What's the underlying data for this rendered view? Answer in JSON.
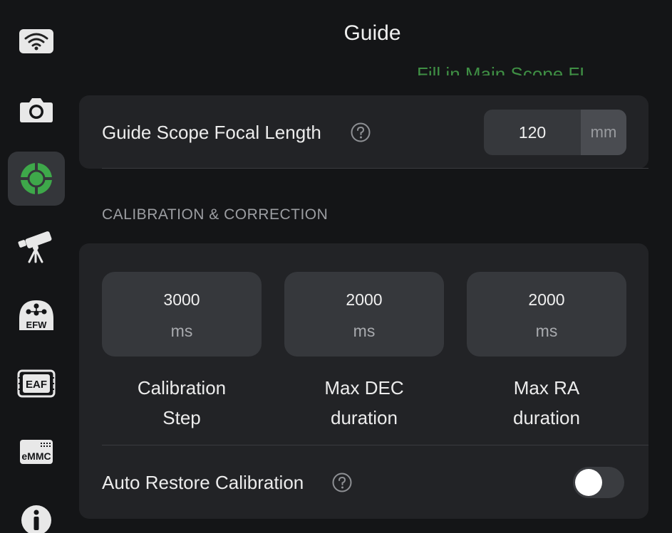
{
  "header": {
    "title": "Guide",
    "partial_text": "Fill in Main Scope FL"
  },
  "sidebar": {
    "items": [
      {
        "name": "wifi-icon",
        "active": false
      },
      {
        "name": "camera-icon",
        "active": false
      },
      {
        "name": "guide-crosshair-icon",
        "active": true
      },
      {
        "name": "telescope-icon",
        "active": false
      },
      {
        "name": "efw-icon",
        "label": "EFW",
        "active": false
      },
      {
        "name": "eaf-icon",
        "label": "EAF",
        "active": false
      },
      {
        "name": "emmc-icon",
        "label": "eMMC",
        "active": false
      },
      {
        "name": "info-icon",
        "active": false
      }
    ]
  },
  "focal": {
    "label": "Guide Scope Focal Length",
    "value": "120",
    "unit": "mm"
  },
  "calibration": {
    "section_title": "CALIBRATION & CORRECTION",
    "params": [
      {
        "value": "3000",
        "unit": "ms",
        "label_line1": "Calibration",
        "label_line2": "Step"
      },
      {
        "value": "2000",
        "unit": "ms",
        "label_line1": "Max DEC",
        "label_line2": "duration"
      },
      {
        "value": "2000",
        "unit": "ms",
        "label_line1": "Max RA",
        "label_line2": "duration"
      }
    ],
    "auto_restore_label": "Auto Restore Calibration",
    "auto_restore_enabled": false
  },
  "colors": {
    "accent_green": "#3ea84a",
    "background": "#141517",
    "card": "#222326"
  }
}
